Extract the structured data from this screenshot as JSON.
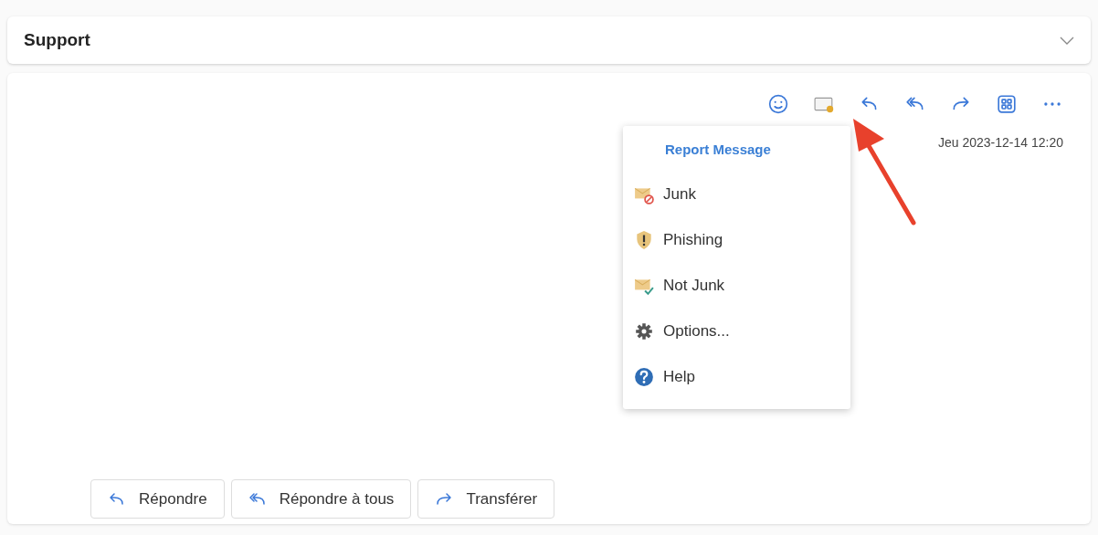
{
  "subject": {
    "title": "Support",
    "expanded": true
  },
  "toolbar": [
    {
      "kind": "emoji"
    },
    {
      "kind": "report"
    },
    {
      "kind": "reply"
    },
    {
      "kind": "reply-all"
    },
    {
      "kind": "forward"
    },
    {
      "kind": "apps"
    },
    {
      "kind": "more"
    }
  ],
  "message": {
    "date": "Jeu 2023-12-14 12:20"
  },
  "report_menu": {
    "title": "Report Message",
    "items": [
      {
        "kind": "junk",
        "label": "Junk"
      },
      {
        "kind": "phishing",
        "label": "Phishing"
      },
      {
        "kind": "not-junk",
        "label": "Not Junk"
      },
      {
        "kind": "options",
        "label": "Options..."
      },
      {
        "kind": "help",
        "label": "Help"
      }
    ]
  },
  "actions": [
    {
      "kind": "reply",
      "label": "Répondre"
    },
    {
      "kind": "reply-all",
      "label": "Répondre à tous"
    },
    {
      "kind": "forward",
      "label": "Transférer"
    }
  ]
}
